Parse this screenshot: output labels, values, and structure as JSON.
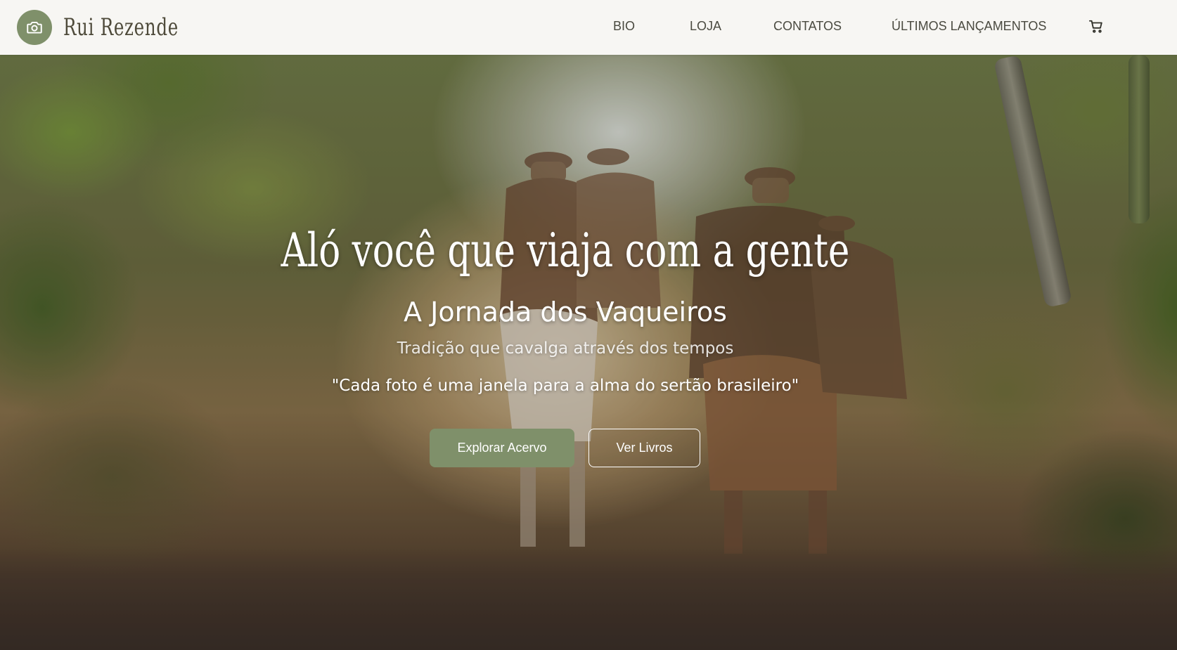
{
  "header": {
    "brand_name": "Rui Rezende",
    "logo_icon": "camera-icon",
    "nav": [
      {
        "label": "BIO"
      },
      {
        "label": "LOJA"
      },
      {
        "label": "CONTATOS"
      },
      {
        "label": "ÚLTIMOS LANÇAMENTOS"
      }
    ],
    "cart_icon": "cart-icon"
  },
  "hero": {
    "title": "Aló você que viaja com a gente",
    "subtitle": "A Jornada dos Vaqueiros",
    "tagline": "Tradição que cavalga através dos tempos",
    "quote": "\"Cada foto é uma janela para a alma do sertão brasileiro\"",
    "primary_button": "Explorar Acervo",
    "secondary_button": "Ver Livros"
  },
  "colors": {
    "accent": "#7f906a",
    "header_bg": "#f7f6f3",
    "nav_text": "#4a4a40"
  }
}
